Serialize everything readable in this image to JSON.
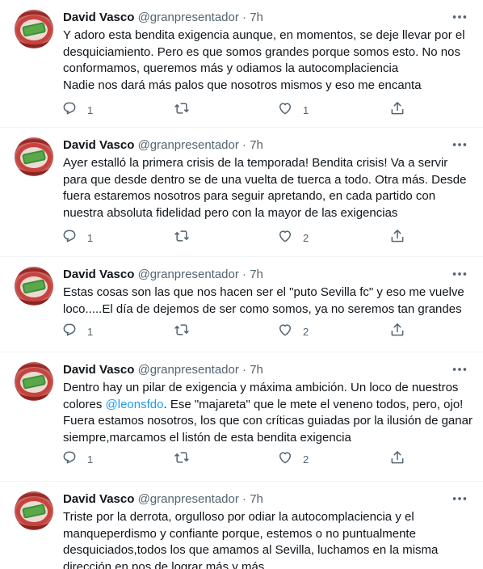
{
  "tweets": [
    {
      "name": "David Vasco",
      "handle": "@granpresentador",
      "time": "7h",
      "lines": [
        "Y adoro esta bendita exigencia aunque, en momentos, se deje llevar por el",
        "desquiciamiento. Pero es que somos grandes porque somos esto. No nos",
        "conformamos, queremos más y odiamos la autocomplaciencia",
        "Nadie nos dará más palos que nosotros mismos y eso me encanta"
      ],
      "replies": "1",
      "retweets": "",
      "likes": "1"
    },
    {
      "name": "David Vasco",
      "handle": "@granpresentador",
      "time": "7h",
      "lines": [
        "Ayer estalló la primera crisis de la temporada! Bendita crisis! Va a servir",
        "para que desde dentro se de una vuelta de tuerca a todo. Otra más. Desde",
        "fuera estaremos nosotros para seguir apretando, en cada partido con",
        "nuestra absoluta fidelidad pero con la mayor de las exigencias"
      ],
      "replies": "1",
      "retweets": "",
      "likes": "2"
    },
    {
      "name": "David Vasco",
      "handle": "@granpresentador",
      "time": "7h",
      "lines": [
        "Estas cosas son las que nos hacen ser el \"puto Sevilla fc\" y eso me vuelve",
        "loco.....El día de dejemos de ser como somos, ya no seremos tan grandes"
      ],
      "replies": "1",
      "retweets": "",
      "likes": "2"
    },
    {
      "name": "David Vasco",
      "handle": "@granpresentador",
      "time": "7h",
      "line1": "Dentro hay un pilar de exigencia y máxima ambición. Un loco de nuestros",
      "line2_before": "colores ",
      "mention": "@leonsfdo",
      "line2_after": ". Ese \"majareta\" que le mete el veneno todos, pero, ojo!",
      "line3": "Fuera estamos nosotros, los que con críticas guiadas por la ilusión de ganar",
      "line4": "siempre,marcamos el listón de esta bendita exigencia",
      "replies": "1",
      "retweets": "",
      "likes": "2"
    },
    {
      "name": "David Vasco",
      "handle": "@granpresentador",
      "time": "7h",
      "lines": [
        "Triste por la derrota, orgulloso por odiar la autocomplaciencia y el",
        "manqueperdismo y confiante porque, estemos o no puntualmente",
        "desquiciados,todos los que amamos al Sevilla, luchamos en la misma",
        "dirección en pos de lograr más y más"
      ]
    }
  ],
  "separator": "·",
  "icons": {
    "more": "more-horizontal-icon",
    "reply": "reply-icon",
    "retweet": "retweet-icon",
    "like": "heart-icon",
    "share": "share-icon"
  },
  "colors": {
    "text": "#0f1419",
    "secondary": "#536471",
    "link": "#1d9bf0",
    "border": "#eff3f4"
  }
}
